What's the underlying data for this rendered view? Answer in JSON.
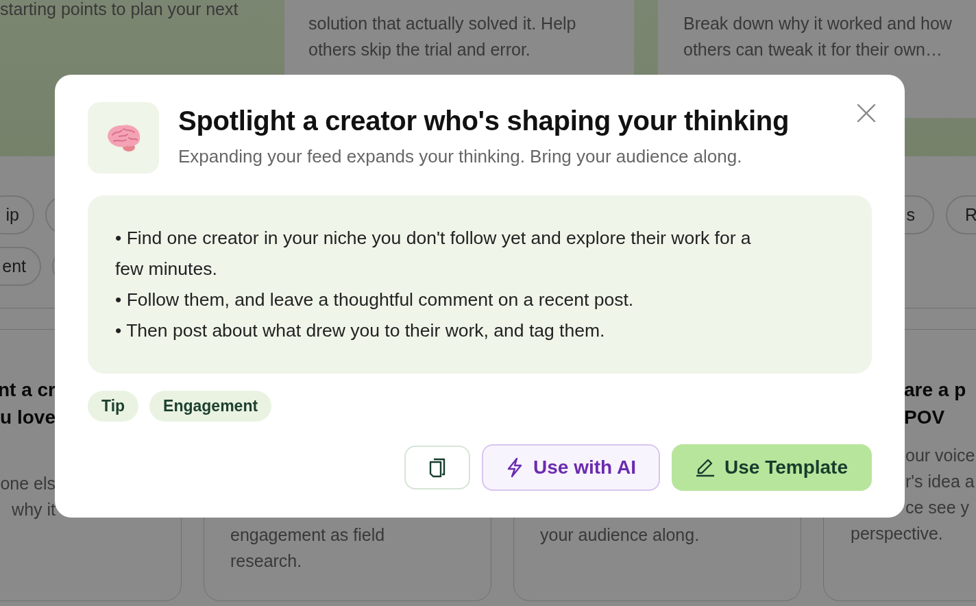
{
  "background": {
    "hero_cards": [
      {
        "lines": [
          "starting points to plan your next"
        ]
      },
      {
        "lines": [
          "solution that actually solved it. Help",
          "others skip the trial and error."
        ]
      },
      {
        "lines": [
          "Break down why it worked and how",
          "others can tweak it for their own…"
        ]
      }
    ],
    "chip_rows": [
      {
        "left": "ip",
        "right": "s"
      },
      {
        "left": "ent",
        "right": ""
      }
    ],
    "chip_right_extra": "R",
    "cards": [
      {
        "title_lines": [
          "nt a cr",
          "u love"
        ],
        "body_lines": [
          "one els",
          "why it"
        ]
      },
      {
        "body_lines": [
          "engagement as field",
          "research."
        ]
      },
      {
        "body_lines": [
          "your audience along."
        ]
      },
      {
        "title_lines": [
          "are a p",
          "POV"
        ],
        "body_lines": [
          "our voice",
          "r's idea a",
          "ce see y",
          "perspective."
        ]
      }
    ]
  },
  "dialog": {
    "title": "Spotlight a creator who's shaping your thinking",
    "subtitle": "Expanding your feed expands your thinking. Bring your audience along.",
    "bullets": [
      "• Find one creator in your niche you don't follow yet and explore their work for a few minutes.",
      "• Follow them, and leave a thoughtful comment on a recent post.",
      "• Then post about what drew you to their work, and tag them."
    ],
    "tags": [
      "Tip",
      "Engagement"
    ],
    "buttons": [
      {
        "kind": "copy"
      },
      {
        "kind": "ai",
        "label": "Use with AI"
      },
      {
        "kind": "template",
        "label": "Use Template"
      }
    ]
  }
}
